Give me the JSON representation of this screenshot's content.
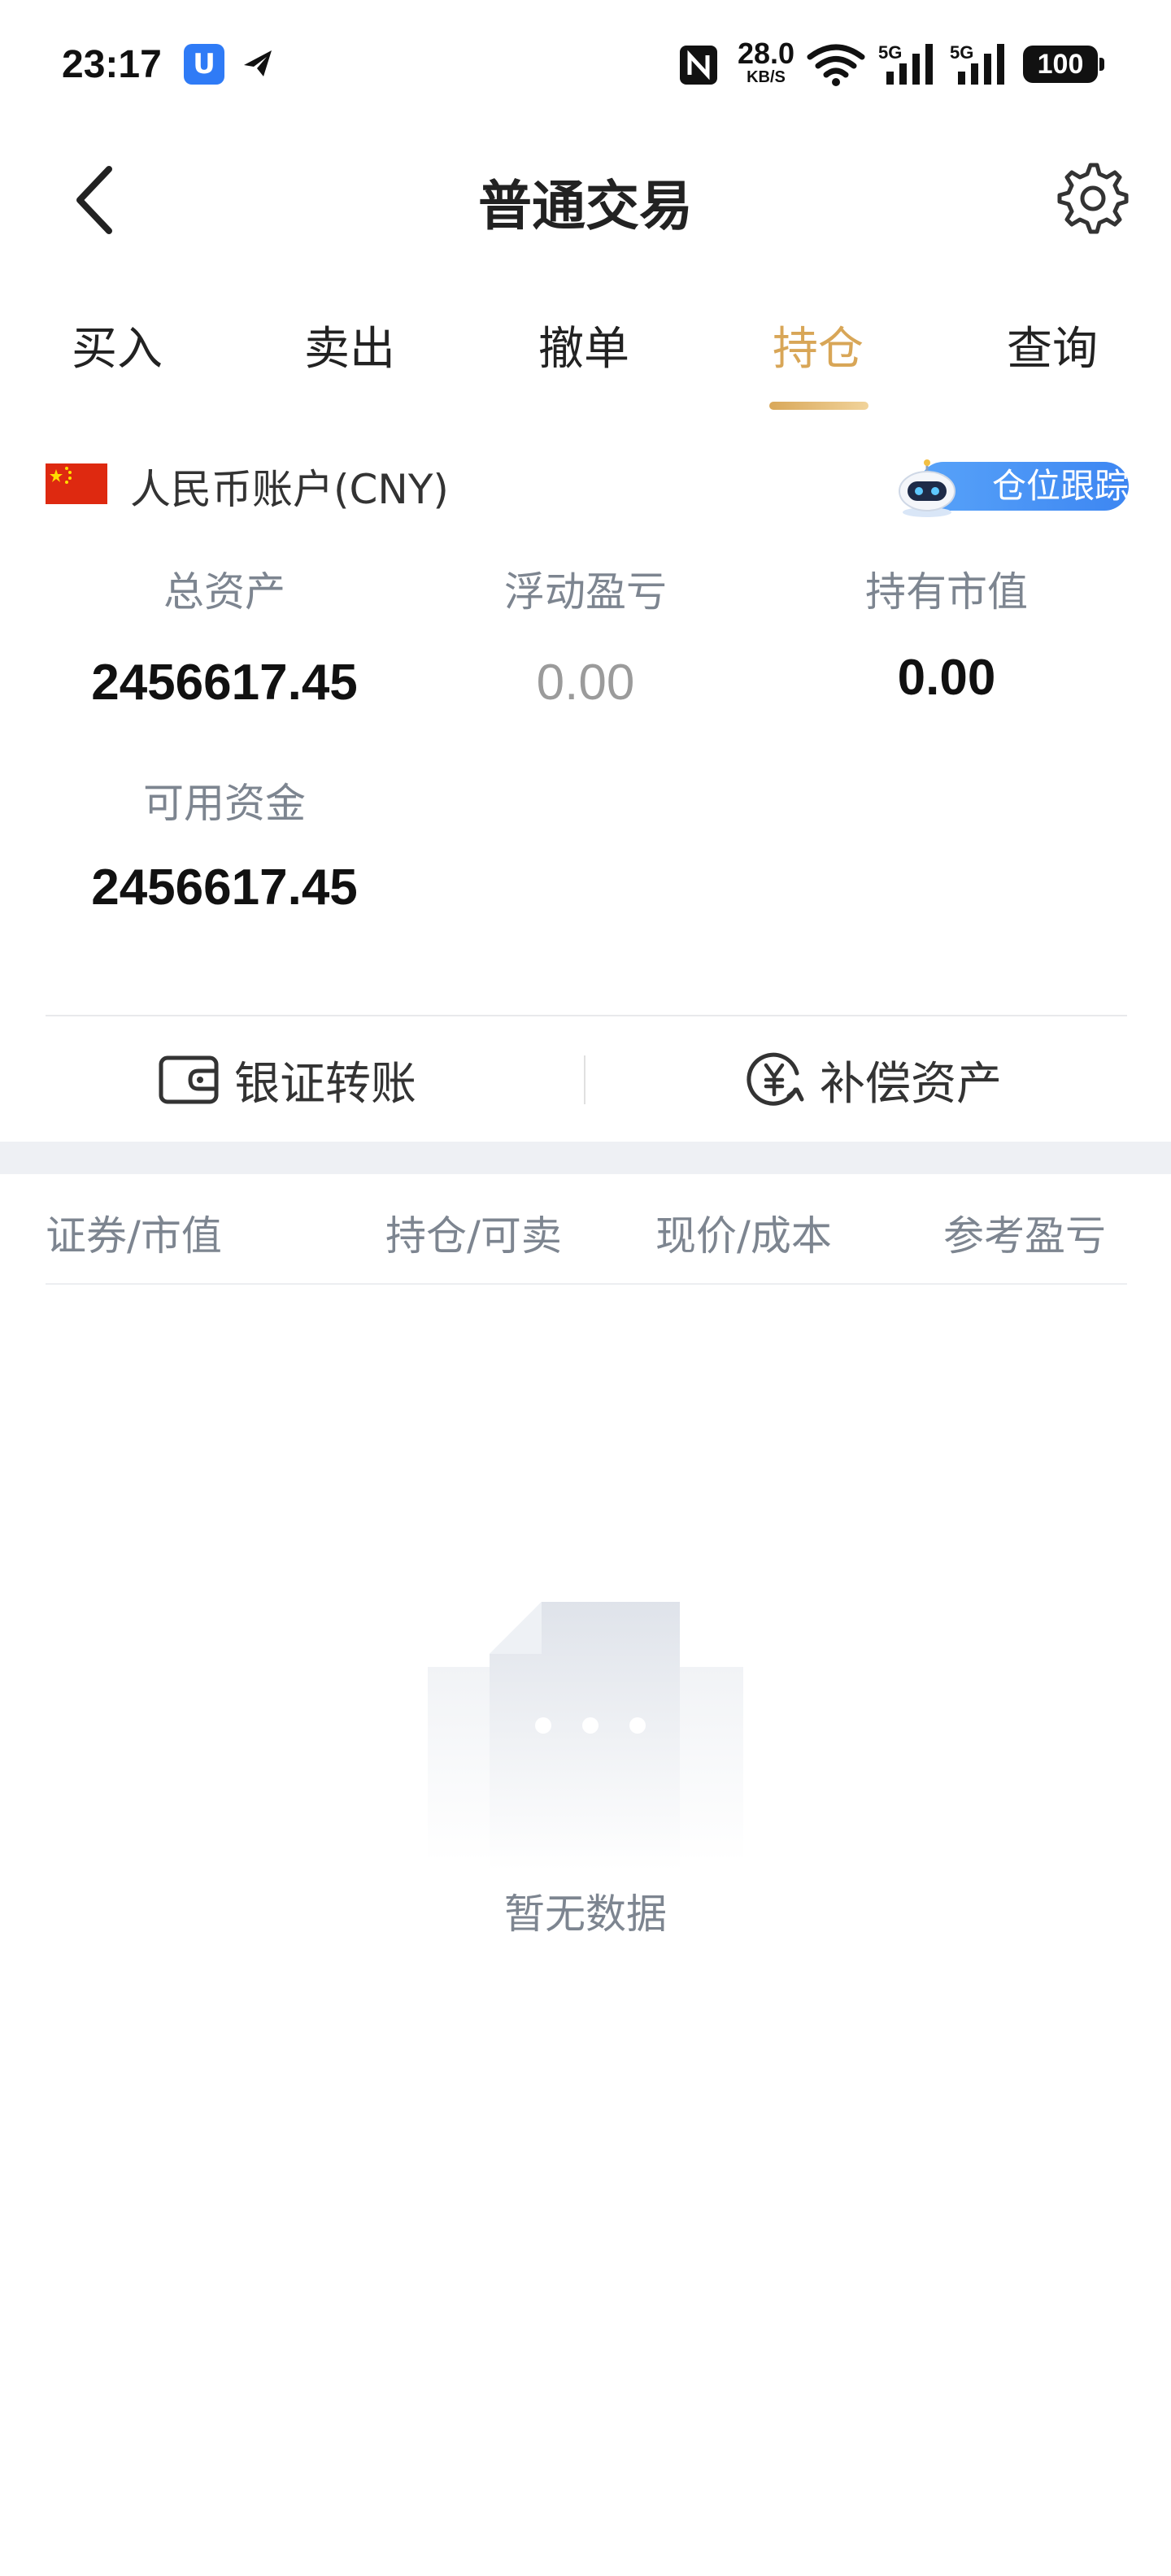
{
  "status_bar": {
    "time": "23:17",
    "app_icon_1": "U",
    "net_speed": "28.0",
    "net_speed_unit": "KB/S",
    "battery": "100",
    "icons": [
      "app-notification-icon",
      "telegram-icon",
      "nfc-icon",
      "wifi-icon",
      "signal-5g-icon",
      "signal-5g-icon"
    ]
  },
  "header": {
    "title": "普通交易",
    "back_icon": "chevron-left-icon",
    "settings_icon": "gear-icon"
  },
  "tabs": [
    {
      "label": "买入",
      "active": false
    },
    {
      "label": "卖出",
      "active": false
    },
    {
      "label": "撤单",
      "active": false
    },
    {
      "label": "持仓",
      "active": true
    },
    {
      "label": "查询",
      "active": false
    }
  ],
  "account": {
    "label": "人民币账户(CNY)",
    "flag": "china-flag-icon",
    "track_button": "仓位跟踪"
  },
  "stats": {
    "total_assets_label": "总资产",
    "total_assets_value": "2456617.45",
    "floating_pnl_label": "浮动盈亏",
    "floating_pnl_value": "0.00",
    "market_value_label": "持有市值",
    "market_value_value": "0.00",
    "available_funds_label": "可用资金",
    "available_funds_value": "2456617.45"
  },
  "actions": {
    "bank_transfer": "银证转账",
    "compensation_assets": "补偿资产"
  },
  "table": {
    "columns": [
      "证券/市值",
      "持仓/可卖",
      "现价/成本",
      "参考盈亏"
    ],
    "rows": []
  },
  "empty_state": {
    "text": "暂无数据"
  },
  "colors": {
    "accent": "#d8a657",
    "badge_blue": "#4a92f5",
    "muted_text": "#7d8590"
  }
}
